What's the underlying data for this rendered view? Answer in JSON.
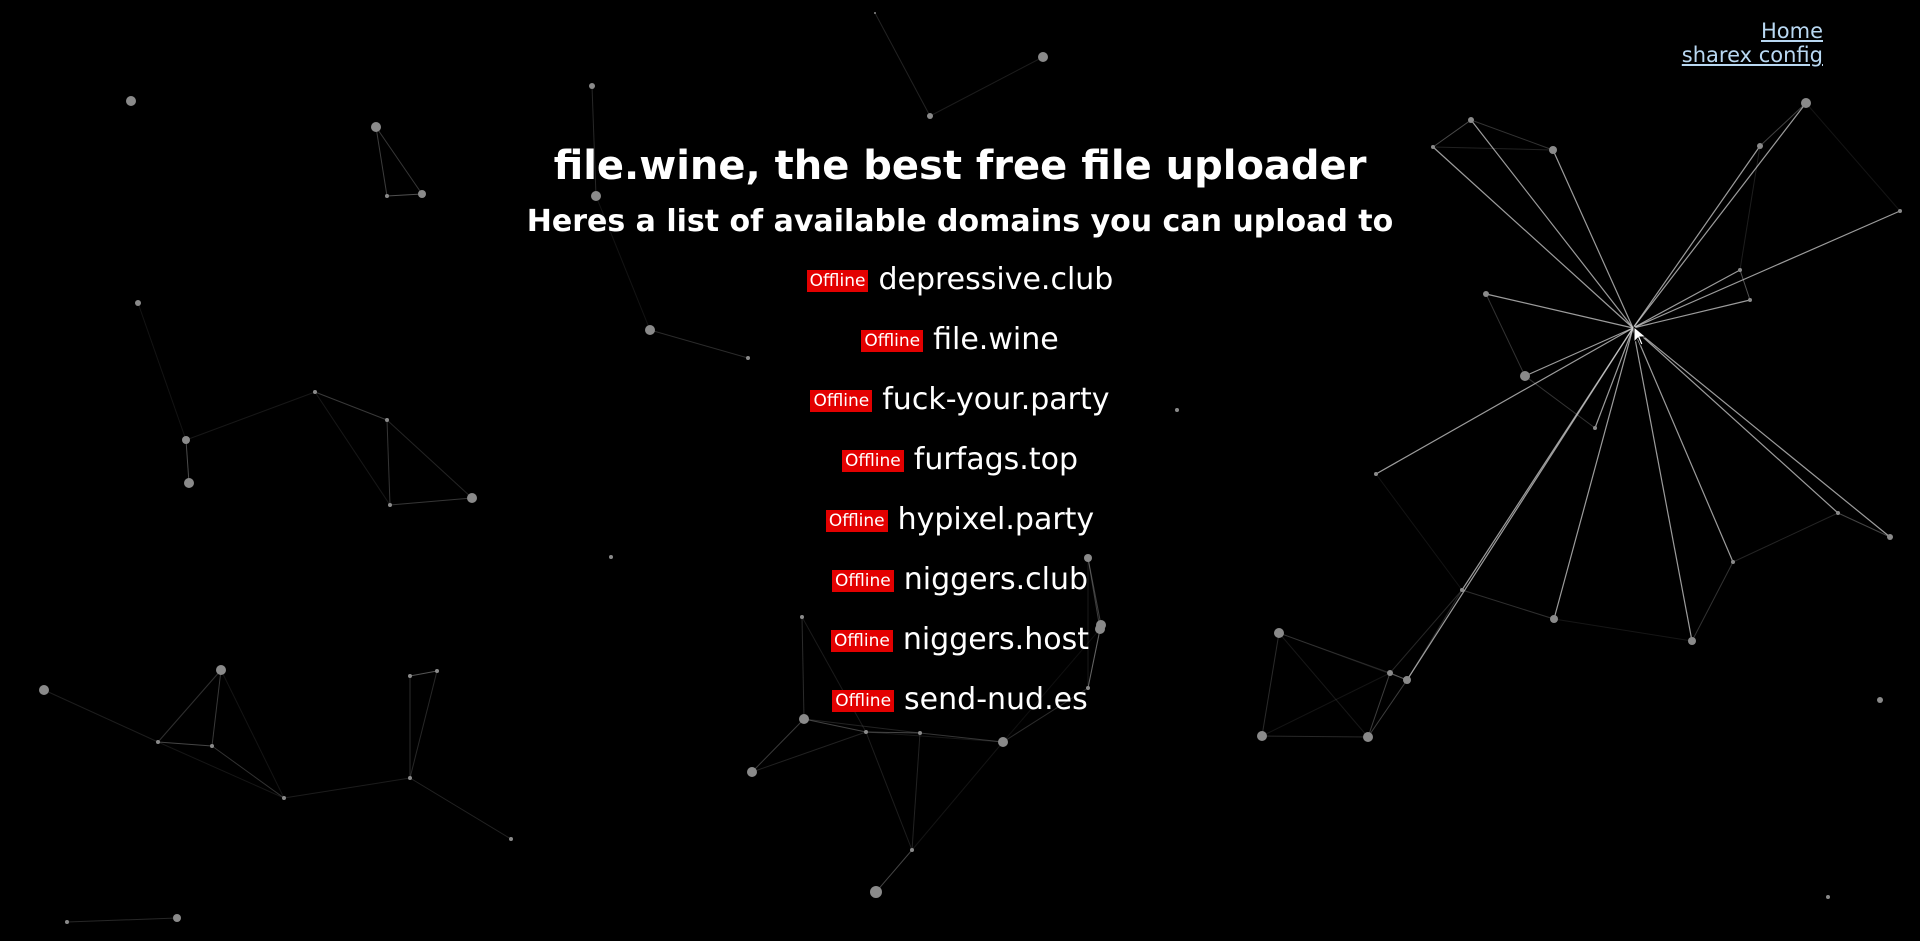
{
  "nav": {
    "home_label": "Home",
    "sharex_label": "sharex config"
  },
  "header": {
    "title": "file.wine, the best free file uploader",
    "subtitle": "Heres a list of available domains you can upload to"
  },
  "domains": [
    {
      "status": "Offline",
      "name": "depressive.club"
    },
    {
      "status": "Offline",
      "name": "file.wine"
    },
    {
      "status": "Offline",
      "name": "fuck-your.party"
    },
    {
      "status": "Offline",
      "name": "furfags.top"
    },
    {
      "status": "Offline",
      "name": "hypixel.party"
    },
    {
      "status": "Offline",
      "name": "niggers.club"
    },
    {
      "status": "Offline",
      "name": "niggers.host"
    },
    {
      "status": "Offline",
      "name": "send-nud.es"
    }
  ],
  "colors": {
    "background": "#000000",
    "text": "#ffffff",
    "offline_badge": "#e30000",
    "link": "#b9d8f2",
    "particle": "#8a8a8a"
  }
}
